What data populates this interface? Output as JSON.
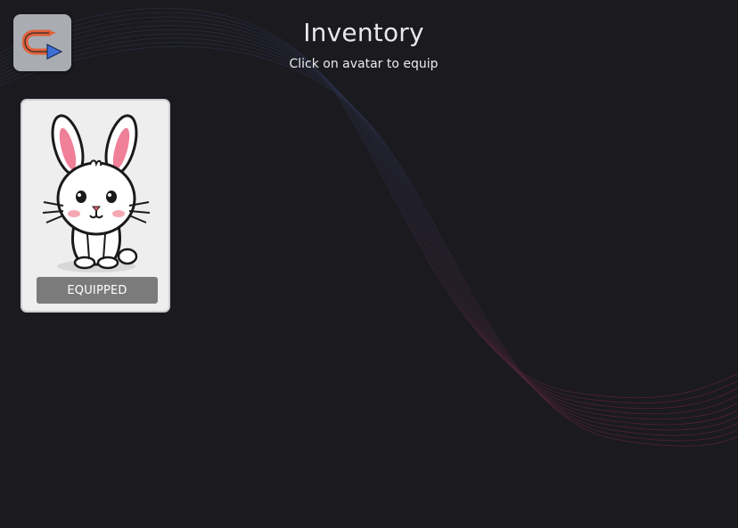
{
  "page": {
    "title": "Inventory",
    "subtitle": "Click on avatar to equip",
    "background_color": "#1b1a1f"
  },
  "back_button": {
    "icon": "u-turn-arrow-icon",
    "accent": "#e0613a"
  },
  "inventory": {
    "items": [
      {
        "avatar": "bunny",
        "icon": "bunny-avatar-icon",
        "status": "EQUIPPED"
      }
    ]
  }
}
